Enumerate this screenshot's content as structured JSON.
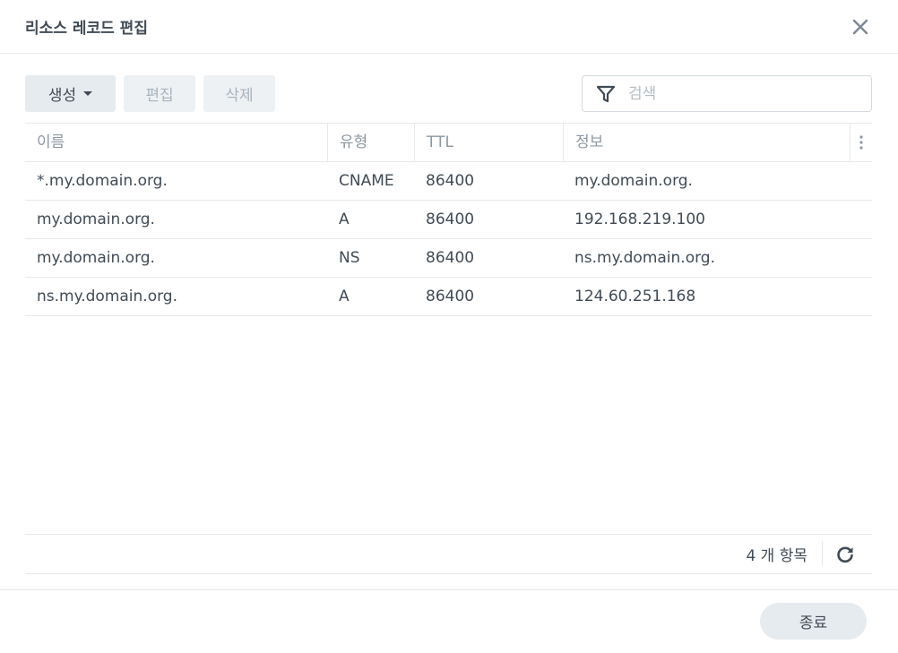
{
  "dialog": {
    "title": "리소스 레코드 편집"
  },
  "toolbar": {
    "create_label": "생성",
    "edit_label": "편집",
    "delete_label": "삭제",
    "search_placeholder": "검색"
  },
  "table": {
    "columns": [
      "이름",
      "유형",
      "TTL",
      "정보"
    ],
    "rows": [
      {
        "name": "*.my.domain.org.",
        "type": "CNAME",
        "ttl": "86400",
        "info": "my.domain.org."
      },
      {
        "name": "my.domain.org.",
        "type": "A",
        "ttl": "86400",
        "info": "192.168.219.100"
      },
      {
        "name": "my.domain.org.",
        "type": "NS",
        "ttl": "86400",
        "info": "ns.my.domain.org."
      },
      {
        "name": "ns.my.domain.org.",
        "type": "A",
        "ttl": "86400",
        "info": "124.60.251.168"
      }
    ]
  },
  "footer": {
    "count_text": "4 개 항목",
    "close_label": "종료"
  },
  "icons": {
    "close": "close-icon",
    "filter": "filter-icon",
    "caret": "chevron-down-icon",
    "column_menu": "more-vertical-icon",
    "refresh": "refresh-icon"
  },
  "colors": {
    "text": "#414b55",
    "muted": "#8e98a3",
    "button_bg": "#e6ebf0",
    "border": "#e6e9ec"
  }
}
